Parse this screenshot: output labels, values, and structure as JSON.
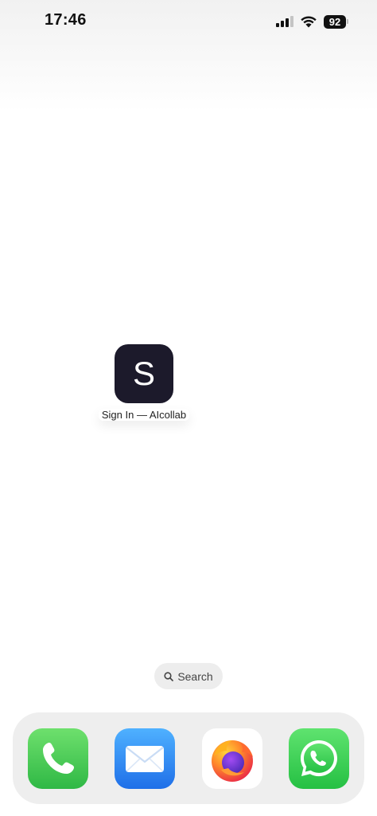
{
  "status_bar": {
    "time": "17:46",
    "battery": "92",
    "icons": [
      "cellular-signal-icon",
      "wifi-icon",
      "battery-icon"
    ]
  },
  "home_screen": {
    "app": {
      "icon_letter": "S",
      "label": "Sign In — AIcollab",
      "icon_bg": "#1c1a2b"
    },
    "search": {
      "label": "Search",
      "icon": "magnifier-icon"
    }
  },
  "dock": {
    "apps": [
      {
        "name": "Phone",
        "icon": "phone-icon",
        "color": "#45c85a"
      },
      {
        "name": "Mail",
        "icon": "mail-icon",
        "color": "#2f7ff0"
      },
      {
        "name": "Firefox",
        "icon": "firefox-icon",
        "color": "#ff7139"
      },
      {
        "name": "WhatsApp",
        "icon": "whatsapp-icon",
        "color": "#2fc84d"
      }
    ]
  }
}
